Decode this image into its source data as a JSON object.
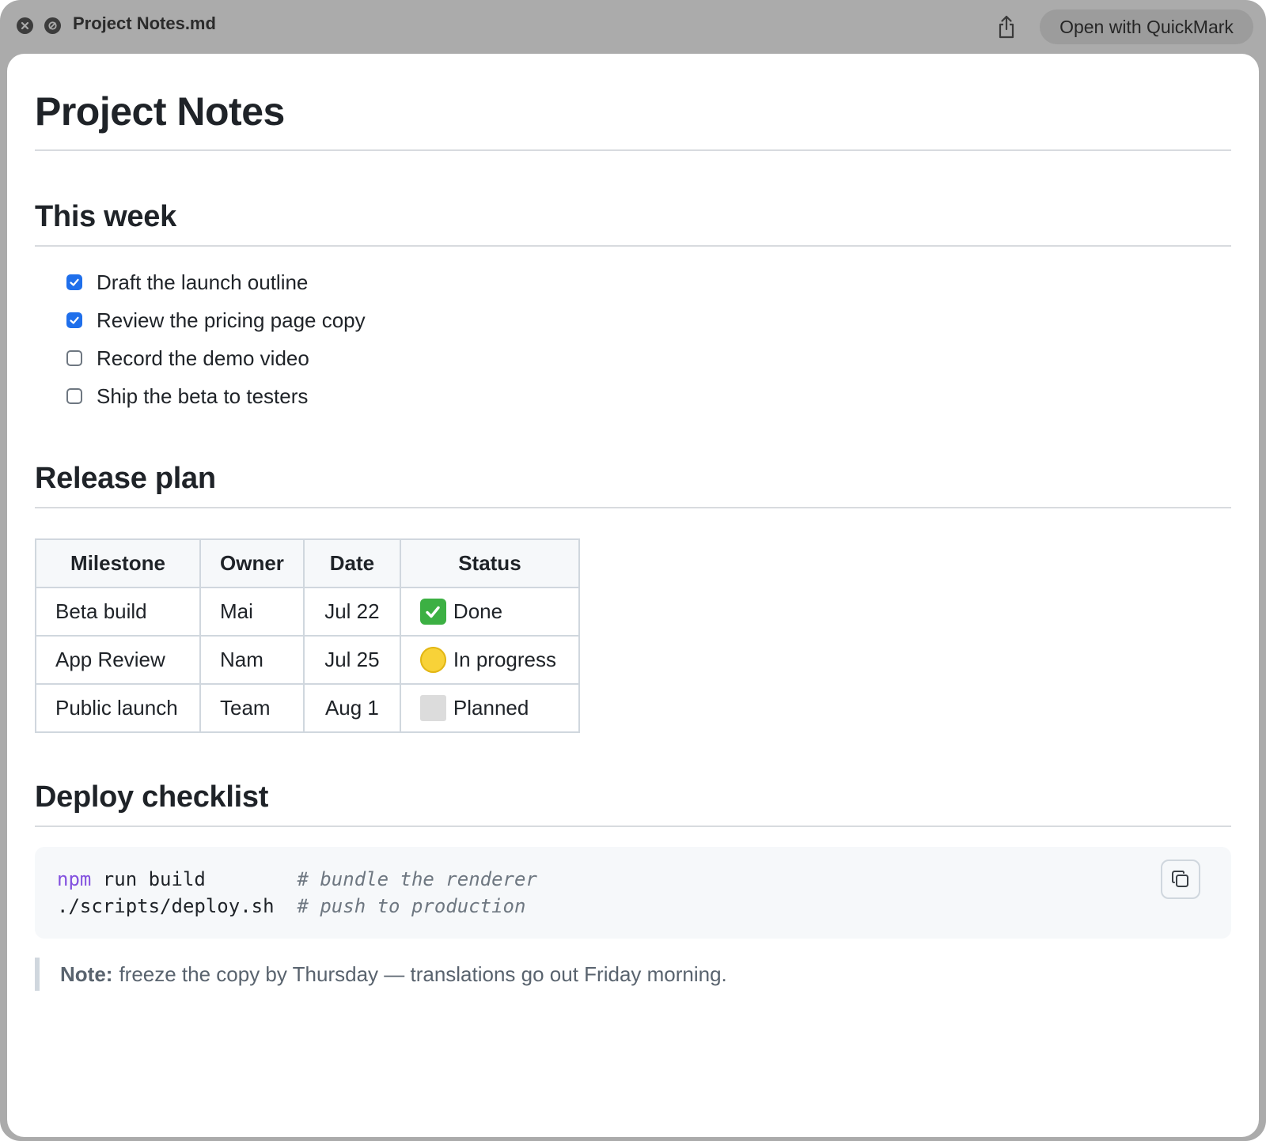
{
  "window": {
    "title": "Project Notes.md",
    "open_with_label": "Open with QuickMark"
  },
  "doc": {
    "title": "Project Notes",
    "sections": {
      "this_week": {
        "heading": "This week",
        "tasks": [
          {
            "label": "Draft the launch outline",
            "checked": true
          },
          {
            "label": "Review the pricing page copy",
            "checked": true
          },
          {
            "label": "Record the demo video",
            "checked": false
          },
          {
            "label": "Ship the beta to testers",
            "checked": false
          }
        ]
      },
      "release_plan": {
        "heading": "Release plan",
        "columns": [
          "Milestone",
          "Owner",
          "Date",
          "Status"
        ],
        "rows": [
          {
            "milestone": "Beta build",
            "owner": "Mai",
            "date": "Jul 22",
            "status": "Done",
            "status_icon": "check-mark-icon"
          },
          {
            "milestone": "App Review",
            "owner": "Nam",
            "date": "Jul 25",
            "status": "In progress",
            "status_icon": "yellow-circle-icon"
          },
          {
            "milestone": "Public launch",
            "owner": "Team",
            "date": "Aug 1",
            "status": "Planned",
            "status_icon": "gray-square-icon"
          }
        ]
      },
      "deploy_checklist": {
        "heading": "Deploy checklist",
        "code_lines": [
          {
            "cmd_keyword": "npm",
            "cmd_rest": " run build",
            "pad": "        ",
            "comment": "# bundle the renderer"
          },
          {
            "cmd_keyword": "",
            "cmd_rest": "./scripts/deploy.sh",
            "pad": "  ",
            "comment": "# push to production"
          }
        ],
        "note_label": "Note:",
        "note_text": "freeze the copy by Thursday — translations go out Friday morning."
      }
    }
  },
  "colors": {
    "checkbox_checked": "#1f6feb",
    "code_keyword": "#8250df",
    "status_done": "#3cb043",
    "status_in_progress": "#f8d238",
    "status_planned": "#dcdcdc"
  }
}
